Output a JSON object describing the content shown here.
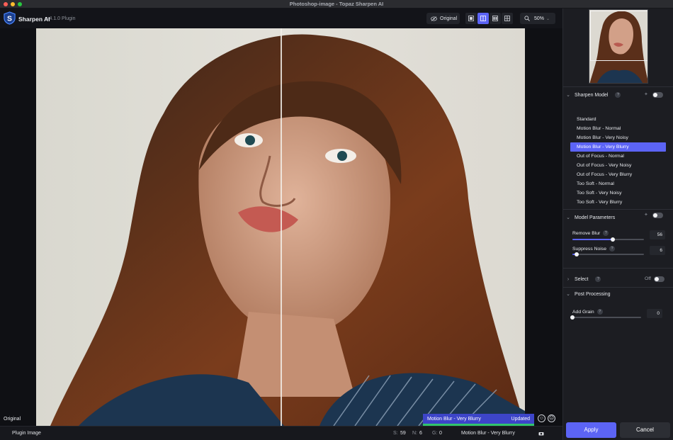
{
  "window": {
    "title": "Photoshop-image - Topaz Sharpen AI"
  },
  "app": {
    "name": "Sharpen AI",
    "version": "v4.1.0 Plugin"
  },
  "toolbar": {
    "original_label": "Original",
    "zoom": "50%",
    "view_modes": [
      "single-view",
      "split-view",
      "side-by-side-view",
      "quad-view"
    ],
    "active_view": "split-view"
  },
  "canvas": {
    "original_label": "Original",
    "model_status": {
      "model": "Motion Blur - Very Blurry",
      "state": "Updated"
    }
  },
  "statusbar": {
    "source": "Plugin Image",
    "s_label": "S:",
    "s_value": "59",
    "n_label": "N:",
    "n_value": "6",
    "g_label": "G:",
    "g_value": "0",
    "model": "Motion Blur - Very Blurry"
  },
  "panel": {
    "sharpen_model": {
      "title": "Sharpen Model",
      "auto_enabled": false,
      "selected": "Motion Blur - Very Blurry",
      "items": [
        "Standard",
        "Motion Blur - Normal",
        "Motion Blur - Very Noisy",
        "Motion Blur - Very Blurry",
        "Out of Focus - Normal",
        "Out of Focus - Very Noisy",
        "Out of Focus - Very Blurry",
        "Too Soft - Normal",
        "Too Soft - Very Noisy",
        "Too Soft - Very Blurry"
      ]
    },
    "model_parameters": {
      "title": "Model Parameters",
      "auto_enabled": false,
      "remove_blur": {
        "label": "Remove Blur",
        "value": "56",
        "fraction": 0.56
      },
      "suppress_noise": {
        "label": "Suppress Noise",
        "value": "6",
        "fraction": 0.06
      }
    },
    "select": {
      "title": "Select",
      "state": "Off"
    },
    "post_processing": {
      "title": "Post Processing",
      "add_grain": {
        "label": "Add Grain",
        "value": "0",
        "fraction": 0
      }
    },
    "apply_label": "Apply",
    "cancel_label": "Cancel"
  },
  "colors": {
    "accent": "#5c64f5",
    "updated_bar": "#31c46d",
    "panel_bg": "#1c1d22"
  }
}
